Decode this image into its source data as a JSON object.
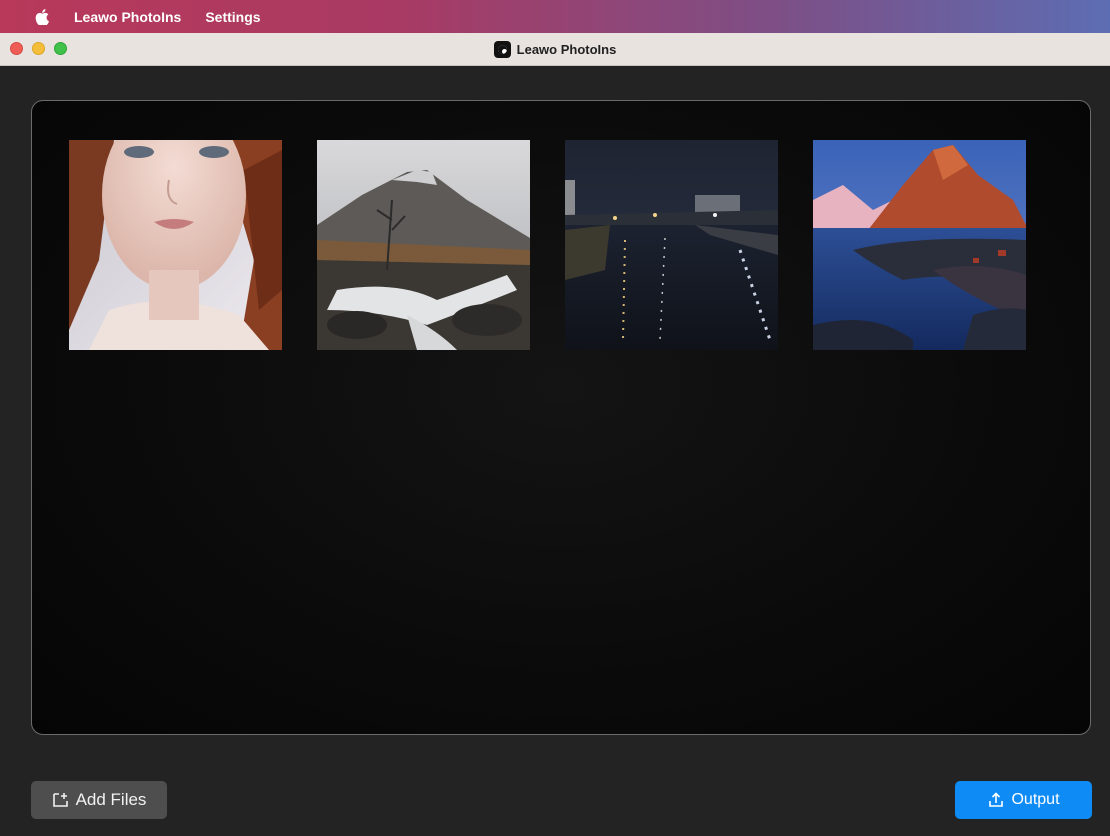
{
  "menubar": {
    "apple_icon": "apple-icon",
    "app_name": "Leawo PhotoIns",
    "items": [
      {
        "label": "Settings"
      }
    ]
  },
  "window": {
    "title": "Leawo PhotoIns",
    "logo_icon": "leawo-photoins-logo-icon",
    "traffic_lights": [
      "close",
      "minimize",
      "zoom"
    ]
  },
  "photos": [
    {
      "subject": "portrait-woman"
    },
    {
      "subject": "mountain-waterfall"
    },
    {
      "subject": "night-river-city"
    },
    {
      "subject": "red-mountain-coast"
    }
  ],
  "toolbar": {
    "add_files_label": "Add Files",
    "add_files_icon": "add-file-icon",
    "output_label": "Output",
    "output_icon": "upload-icon"
  },
  "colors": {
    "accent": "#0f8bf5",
    "background": "#232323",
    "panel": "#0b0b0b"
  }
}
